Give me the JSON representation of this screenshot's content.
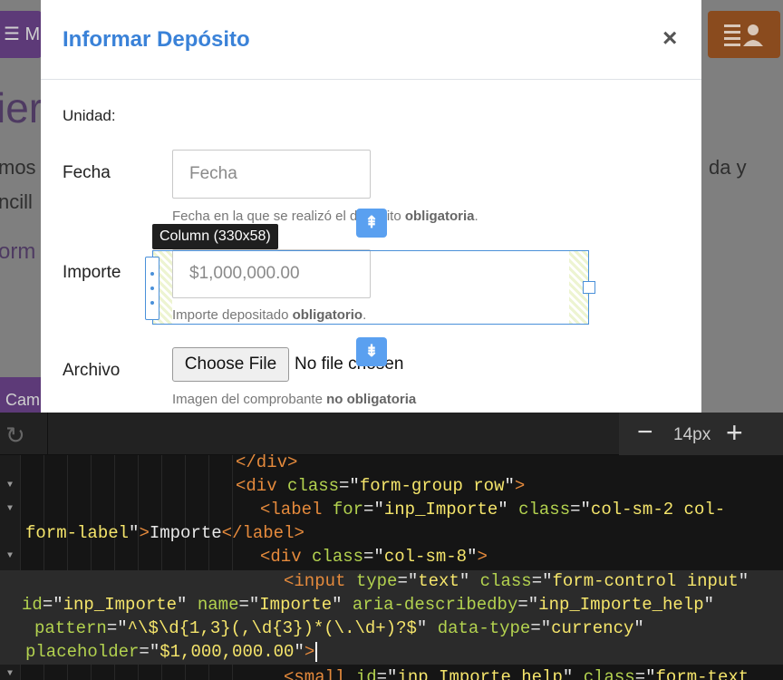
{
  "background": {
    "menu_button_label": "☰ M",
    "heading_fragment": "ier",
    "text_fragment_1": "mos",
    "text_fragment_2": "ncill",
    "text_fragment_right": "da y",
    "link_fragment": "orm",
    "camera_button_label": "Cam"
  },
  "modal": {
    "title": "Informar Depósito",
    "close_label": "×",
    "unidad_label": "Unidad:",
    "fecha": {
      "label": "Fecha",
      "placeholder": "Fecha",
      "help_text": "Fecha en la que se realizó el depósito ",
      "help_bold": "obligatoria",
      "help_end": "."
    },
    "importe": {
      "label": "Importe",
      "placeholder": "$1,000,000.00",
      "help_text": "Importe depositado ",
      "help_bold": "obligatorio",
      "help_end": "."
    },
    "archivo": {
      "label": "Archivo",
      "button_label": "Choose File",
      "status": "No file chosen",
      "help_text": "Imagen del comprobante ",
      "help_bold": "no obligatoria"
    }
  },
  "inspector": {
    "tooltip": "Column (330x58)",
    "move_up_icon": "move-up-icon",
    "move_down_icon": "move-down-icon"
  },
  "editor": {
    "font_size": "14px",
    "zoom_out_label": "−",
    "zoom_in_label": "+"
  }
}
